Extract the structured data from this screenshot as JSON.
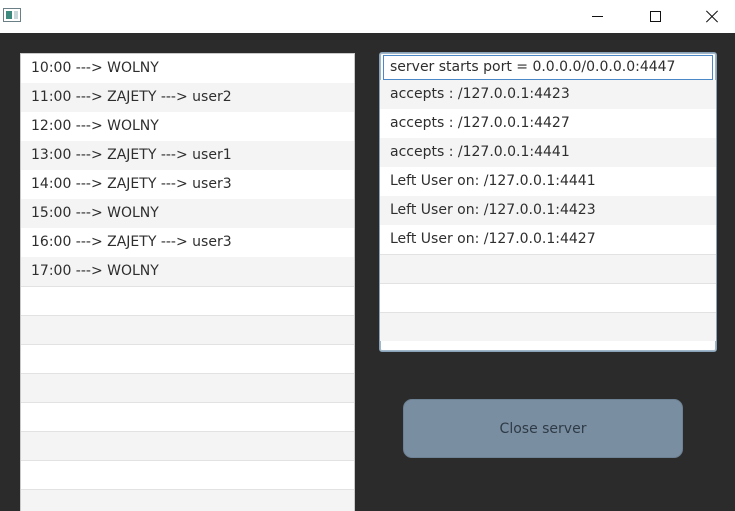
{
  "window": {
    "icon": "java-app-icon",
    "controls": {
      "minimize": "minimize-icon",
      "maximize": "maximize-icon",
      "close": "close-icon"
    }
  },
  "schedule": {
    "items": [
      "10:00 ---> WOLNY",
      "11:00 ---> ZAJETY ---> user2",
      "12:00 ---> WOLNY",
      "13:00 ---> ZAJETY ---> user1",
      "14:00 ---> ZAJETY ---> user3",
      "15:00 ---> WOLNY",
      "16:00 ---> ZAJETY ---> user3",
      "17:00 ---> WOLNY"
    ]
  },
  "log": {
    "items": [
      "server starts port = 0.0.0.0/0.0.0.0:4447",
      "accepts : /127.0.0.1:4423",
      "accepts : /127.0.0.1:4427",
      "accepts : /127.0.0.1:4441",
      "Left User on: /127.0.0.1:4441",
      "Left User on: /127.0.0.1:4423",
      "Left User on: /127.0.0.1:4427"
    ]
  },
  "actions": {
    "close_server": "Close server"
  },
  "colors": {
    "background": "#2b2b2b",
    "button": "#7a8ea1",
    "selection_border": "#4a88c8"
  }
}
